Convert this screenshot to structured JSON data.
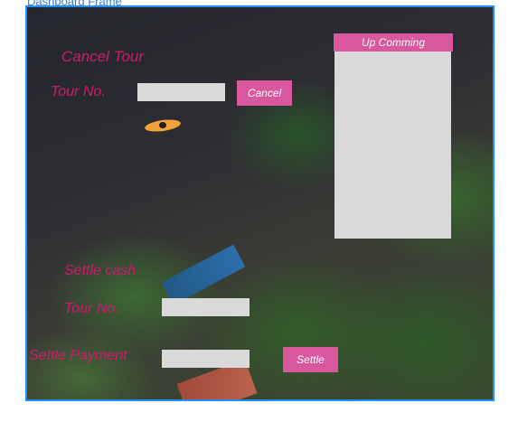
{
  "frame": {
    "title": "Dashboard Frame"
  },
  "cancel_tour": {
    "heading": "Cancel Tour",
    "tour_label": "Tour No.",
    "tour_input_value": "",
    "cancel_button": "Cancel"
  },
  "upcoming": {
    "title": "Up Comming",
    "items": []
  },
  "settle": {
    "heading": "Settle cash",
    "tour_label": "Tour No.",
    "tour_input_value": "",
    "payment_label": "Settle Payment",
    "payment_input_value": "",
    "settle_button": "Settle"
  },
  "colors": {
    "accent_pink": "#d2196e",
    "button_pink": "#d9579c",
    "frame_border": "#1e8fff",
    "field_gray": "#d9d9d9"
  }
}
